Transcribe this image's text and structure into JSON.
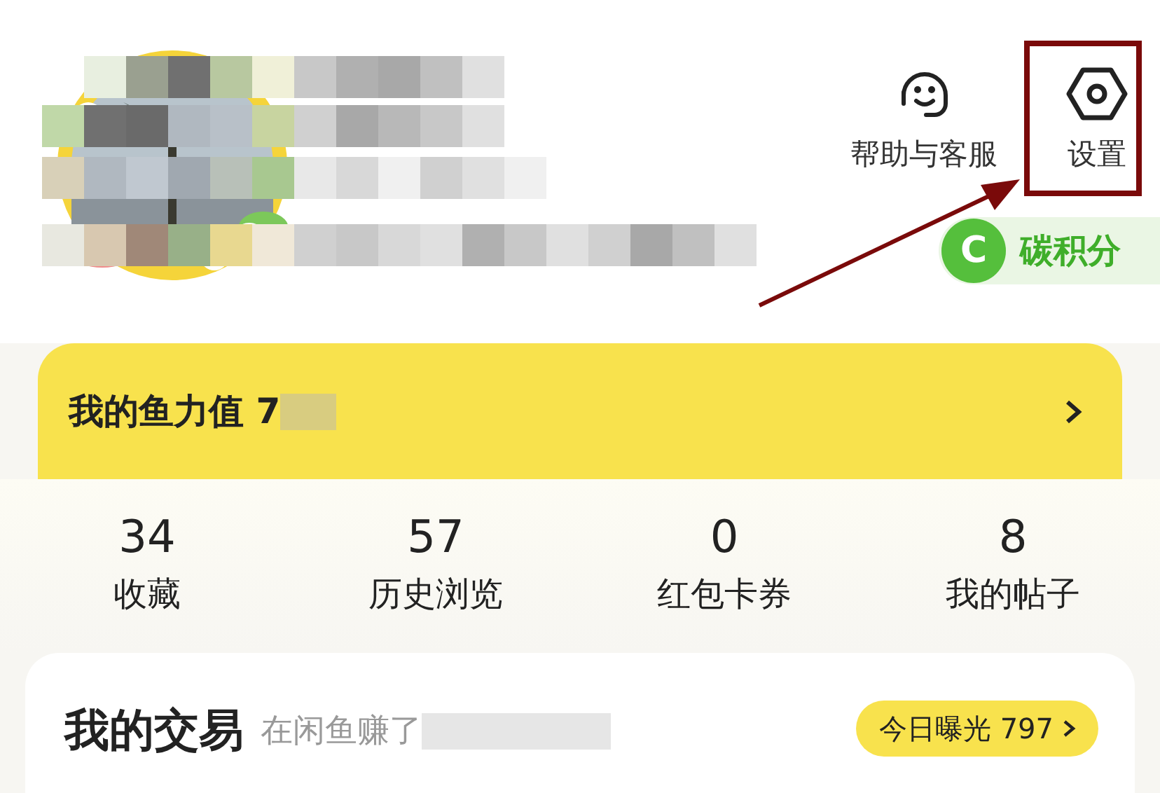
{
  "header": {
    "help": {
      "label": "帮助与客服"
    },
    "settings": {
      "label": "设置"
    },
    "carbon": {
      "badge": "C",
      "label": "碳积分"
    }
  },
  "fish_power": {
    "label": "我的鱼力值 7"
  },
  "stats": [
    {
      "value": "34",
      "label": "收藏"
    },
    {
      "value": "57",
      "label": "历史浏览"
    },
    {
      "value": "0",
      "label": "红包卡券"
    },
    {
      "value": "8",
      "label": "我的帖子"
    }
  ],
  "trade": {
    "title": "我的交易",
    "subtitle": "在闲鱼赚了",
    "exposure": "今日曝光 797"
  }
}
